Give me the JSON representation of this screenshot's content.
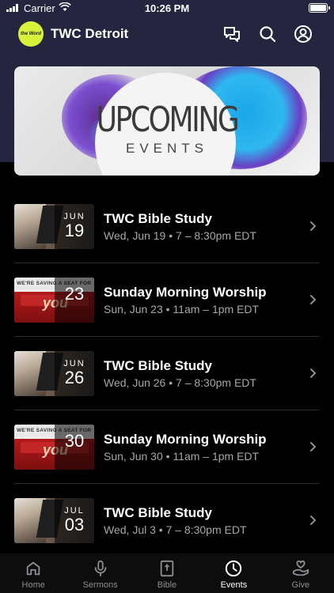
{
  "status_bar": {
    "carrier": "Carrier",
    "time": "10:26 PM"
  },
  "header": {
    "title": "TWC Detroit",
    "logo_text": "the Word",
    "colors": {
      "header_bg": "#252540",
      "logo_bg": "#d6f23a"
    }
  },
  "banner": {
    "title": "UPCOMING",
    "subtitle": "EVENTS"
  },
  "events": [
    {
      "title": "TWC Bible Study",
      "subtitle": "Wed, Jun 19 • 7 – 8:30pm EDT",
      "month": "JUN",
      "day": "19",
      "thumb": "bible-study"
    },
    {
      "title": "Sunday Morning Worship",
      "subtitle": "Sun, Jun 23 • 11am – 1pm EDT",
      "month": "",
      "day": "23",
      "thumb": "worship",
      "thumb_text": "WE'RE SAVING A SEAT FOR",
      "thumb_word": "you"
    },
    {
      "title": "TWC Bible Study",
      "subtitle": "Wed, Jun 26 • 7 – 8:30pm EDT",
      "month": "JUN",
      "day": "26",
      "thumb": "bible-study"
    },
    {
      "title": "Sunday Morning Worship",
      "subtitle": "Sun, Jun 30 • 11am – 1pm EDT",
      "month": "",
      "day": "30",
      "thumb": "worship",
      "thumb_text": "WE'RE SAVING A SEAT FOR",
      "thumb_word": "you"
    },
    {
      "title": "TWC Bible Study",
      "subtitle": "Wed, Jul 3 • 7 – 8:30pm EDT",
      "month": "JUL",
      "day": "03",
      "thumb": "bible-study"
    }
  ],
  "tabs": [
    {
      "label": "Home",
      "icon": "home-icon",
      "active": false
    },
    {
      "label": "Sermons",
      "icon": "microphone-icon",
      "active": false
    },
    {
      "label": "Bible",
      "icon": "bible-icon",
      "active": false
    },
    {
      "label": "Events",
      "icon": "clock-icon",
      "active": true
    },
    {
      "label": "Give",
      "icon": "give-icon",
      "active": false
    }
  ]
}
